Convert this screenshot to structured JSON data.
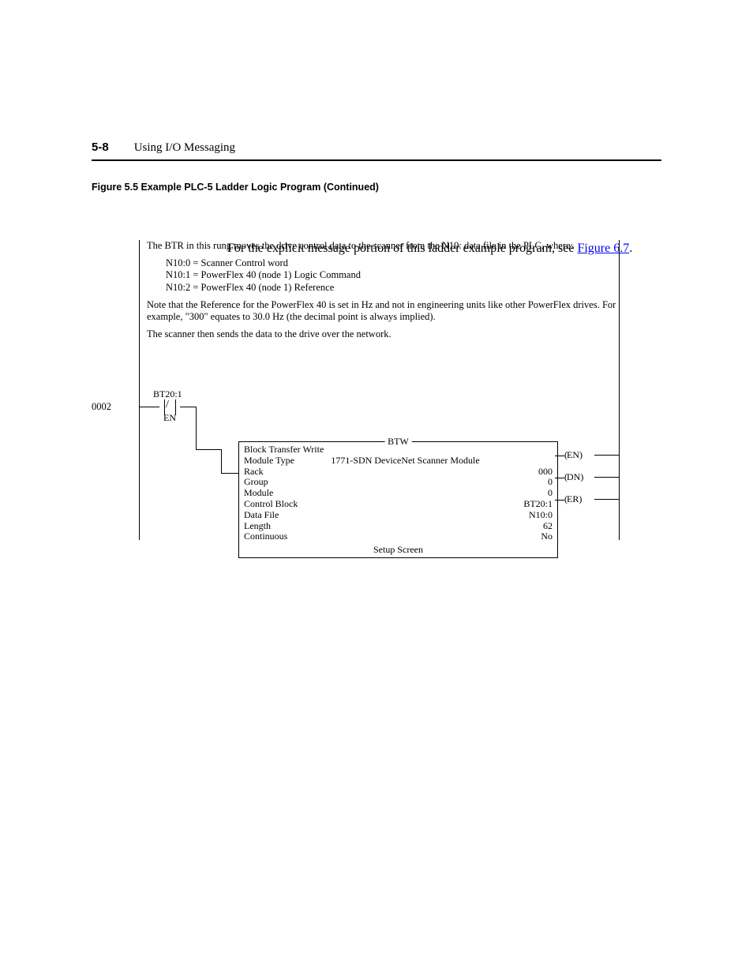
{
  "header": {
    "pagenum": "5-8",
    "title": "Using I/O Messaging"
  },
  "figure": {
    "caption": "Figure 5.5   Example PLC-5 Ladder Logic Program (Continued)"
  },
  "rung": {
    "num": "0002",
    "intro": "The BTR in this rung moves the drive control data to the scanner from the N10: data file in the PLC, where:",
    "defs": [
      "N10:0 = Scanner Control word",
      "N10:1 = PowerFlex 40 (node 1) Logic Command",
      "N10:2 = PowerFlex 40 (node 1) Reference"
    ],
    "note": "Note that the Reference for the PowerFlex 40 is set in Hz and not in engineering units like other PowerFlex drives.  For example, \"300\" equates to 30.0 Hz (the decimal point is always implied).",
    "scan": "The scanner then sends the data to the drive over the network.",
    "contact_top": "BT20:1",
    "contact_bot": "EN"
  },
  "outbox": {
    "title": "BTW",
    "rows": [
      {
        "l": "Block Transfer Write",
        "r": ""
      },
      {
        "l": "Module Type",
        "r": "1771-SDN DeviceNet Scanner Module"
      },
      {
        "l": "Rack",
        "r": "000"
      },
      {
        "l": "Group",
        "r": "0"
      },
      {
        "l": "Module",
        "r": "0"
      },
      {
        "l": "Control Block",
        "r": "BT20:1"
      },
      {
        "l": "Data File",
        "r": "N10:0"
      },
      {
        "l": "Length",
        "r": "62"
      },
      {
        "l": "Continuous",
        "r": "No"
      }
    ],
    "setup": "Setup Screen"
  },
  "coils": {
    "en": "EN",
    "dn": "DN",
    "er": "ER"
  },
  "follow": {
    "text_before": "For the explicit message portion of this ladder example program, see ",
    "link": "Figure 6.7",
    "text_after": "."
  }
}
